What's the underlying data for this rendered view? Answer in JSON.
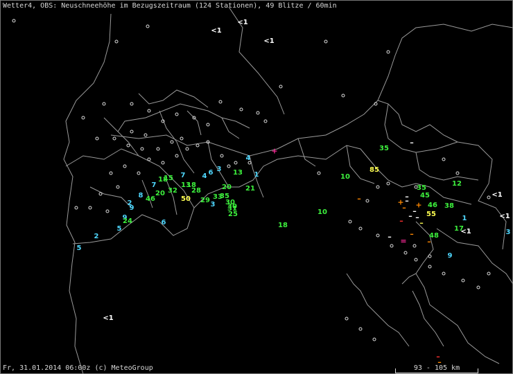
{
  "header": {
    "title": "Wetter4, OBS: Neuschneehöhe im Bezugszeitraum (124 Stationen), 49 Blitze / 60min"
  },
  "footer": {
    "timestamp": "Fr, 31.01.2014 06:00z (c) MeteoGroup",
    "scale_label": "93 - 105 km"
  },
  "colors": {
    "cyan": "#4fd8ff",
    "green": "#3df03d",
    "yellow": "#ffff50",
    "white": "#ffffff",
    "orange": "#ff8800",
    "red": "#ff3030",
    "magenta": "#ff2a9a",
    "border": "#aaaaaa"
  },
  "observations": [
    {
      "id": "o1",
      "value": "<1",
      "color": "white"
    },
    {
      "id": "o2",
      "value": "<1",
      "color": "white"
    },
    {
      "id": "o3",
      "value": "<1",
      "color": "white"
    },
    {
      "id": "o4",
      "value": "4",
      "color": "cyan"
    },
    {
      "id": "o5",
      "value": "3",
      "color": "cyan"
    },
    {
      "id": "o6",
      "value": "6",
      "color": "cyan"
    },
    {
      "id": "o7",
      "value": "4",
      "color": "cyan"
    },
    {
      "id": "o8",
      "value": "7",
      "color": "cyan"
    },
    {
      "id": "o9",
      "value": "1",
      "color": "cyan"
    },
    {
      "id": "o10",
      "value": "13",
      "color": "green"
    },
    {
      "id": "o11",
      "value": "18",
      "color": "green"
    },
    {
      "id": "o12",
      "value": "15",
      "color": "green"
    },
    {
      "id": "o13",
      "value": "7",
      "color": "cyan"
    },
    {
      "id": "o14",
      "value": "20",
      "color": "green"
    },
    {
      "id": "o15",
      "value": "32",
      "color": "green"
    },
    {
      "id": "o16",
      "value": "13",
      "color": "green"
    },
    {
      "id": "o17",
      "value": "18",
      "color": "green"
    },
    {
      "id": "o18",
      "value": "28",
      "color": "green"
    },
    {
      "id": "o19",
      "value": "20",
      "color": "green"
    },
    {
      "id": "o20",
      "value": "21",
      "color": "green"
    },
    {
      "id": "o21",
      "value": "8",
      "color": "cyan"
    },
    {
      "id": "o22",
      "value": "46",
      "color": "green"
    },
    {
      "id": "o23",
      "value": "50",
      "color": "yellow"
    },
    {
      "id": "o24",
      "value": "29",
      "color": "green"
    },
    {
      "id": "o25",
      "value": "33",
      "color": "green"
    },
    {
      "id": "o26",
      "value": "35",
      "color": "green"
    },
    {
      "id": "o27",
      "value": "3",
      "color": "cyan"
    },
    {
      "id": "o28",
      "value": "30",
      "color": "green"
    },
    {
      "id": "o29",
      "value": "31",
      "color": "green"
    },
    {
      "id": "o30",
      "value": "30",
      "color": "green"
    },
    {
      "id": "o31",
      "value": "25",
      "color": "green"
    },
    {
      "id": "o32",
      "value": "2",
      "color": "cyan"
    },
    {
      "id": "o33",
      "value": "9",
      "color": "cyan"
    },
    {
      "id": "o34",
      "value": "9",
      "color": "cyan"
    },
    {
      "id": "o35",
      "value": "24",
      "color": "green"
    },
    {
      "id": "o36",
      "value": "5",
      "color": "cyan"
    },
    {
      "id": "o37",
      "value": "6",
      "color": "cyan"
    },
    {
      "id": "o38",
      "value": "2",
      "color": "cyan"
    },
    {
      "id": "o39",
      "value": "5",
      "color": "cyan"
    },
    {
      "id": "o40",
      "value": "18",
      "color": "green"
    },
    {
      "id": "o41",
      "value": "10",
      "color": "green"
    },
    {
      "id": "o42",
      "value": "10",
      "color": "green"
    },
    {
      "id": "o43",
      "value": "35",
      "color": "green"
    },
    {
      "id": "o44",
      "value": "85",
      "color": "yellow"
    },
    {
      "id": "o45",
      "value": "35",
      "color": "green"
    },
    {
      "id": "o46",
      "value": "45",
      "color": "green"
    },
    {
      "id": "o47",
      "value": "12",
      "color": "green"
    },
    {
      "id": "o48",
      "value": "46",
      "color": "green"
    },
    {
      "id": "o49",
      "value": "38",
      "color": "green"
    },
    {
      "id": "o50",
      "value": "55",
      "color": "yellow"
    },
    {
      "id": "o51",
      "value": "17",
      "color": "green"
    },
    {
      "id": "o52",
      "value": "48",
      "color": "green"
    },
    {
      "id": "o53",
      "value": "1",
      "color": "cyan"
    },
    {
      "id": "o54",
      "value": "<1",
      "color": "white"
    },
    {
      "id": "o55",
      "value": "<1",
      "color": "white"
    },
    {
      "id": "o56",
      "value": "<1",
      "color": "white"
    },
    {
      "id": "o57",
      "value": "3",
      "color": "cyan"
    },
    {
      "id": "o58",
      "value": "9",
      "color": "cyan"
    },
    {
      "id": "o59",
      "value": "<1",
      "color": "white"
    }
  ],
  "lightning": [
    {
      "symbol": "+",
      "color": "magenta"
    },
    {
      "symbol": "–",
      "color": "white"
    },
    {
      "symbol": "–",
      "color": "orange"
    },
    {
      "symbol": "–",
      "color": "white"
    },
    {
      "symbol": "–",
      "color": "white"
    },
    {
      "symbol": "+",
      "color": "orange"
    },
    {
      "symbol": "+",
      "color": "orange"
    },
    {
      "symbol": "–",
      "color": "orange"
    },
    {
      "symbol": "–",
      "color": "white"
    },
    {
      "symbol": "–",
      "color": "white"
    },
    {
      "symbol": "–",
      "color": "white"
    },
    {
      "symbol": "–",
      "color": "red"
    },
    {
      "symbol": "–",
      "color": "yellow"
    },
    {
      "symbol": "–",
      "color": "white"
    },
    {
      "symbol": "–",
      "color": "orange"
    },
    {
      "symbol": "=",
      "color": "magenta"
    },
    {
      "symbol": "–",
      "color": "orange"
    },
    {
      "symbol": "–",
      "color": "red"
    },
    {
      "symbol": "–",
      "color": "orange"
    }
  ]
}
